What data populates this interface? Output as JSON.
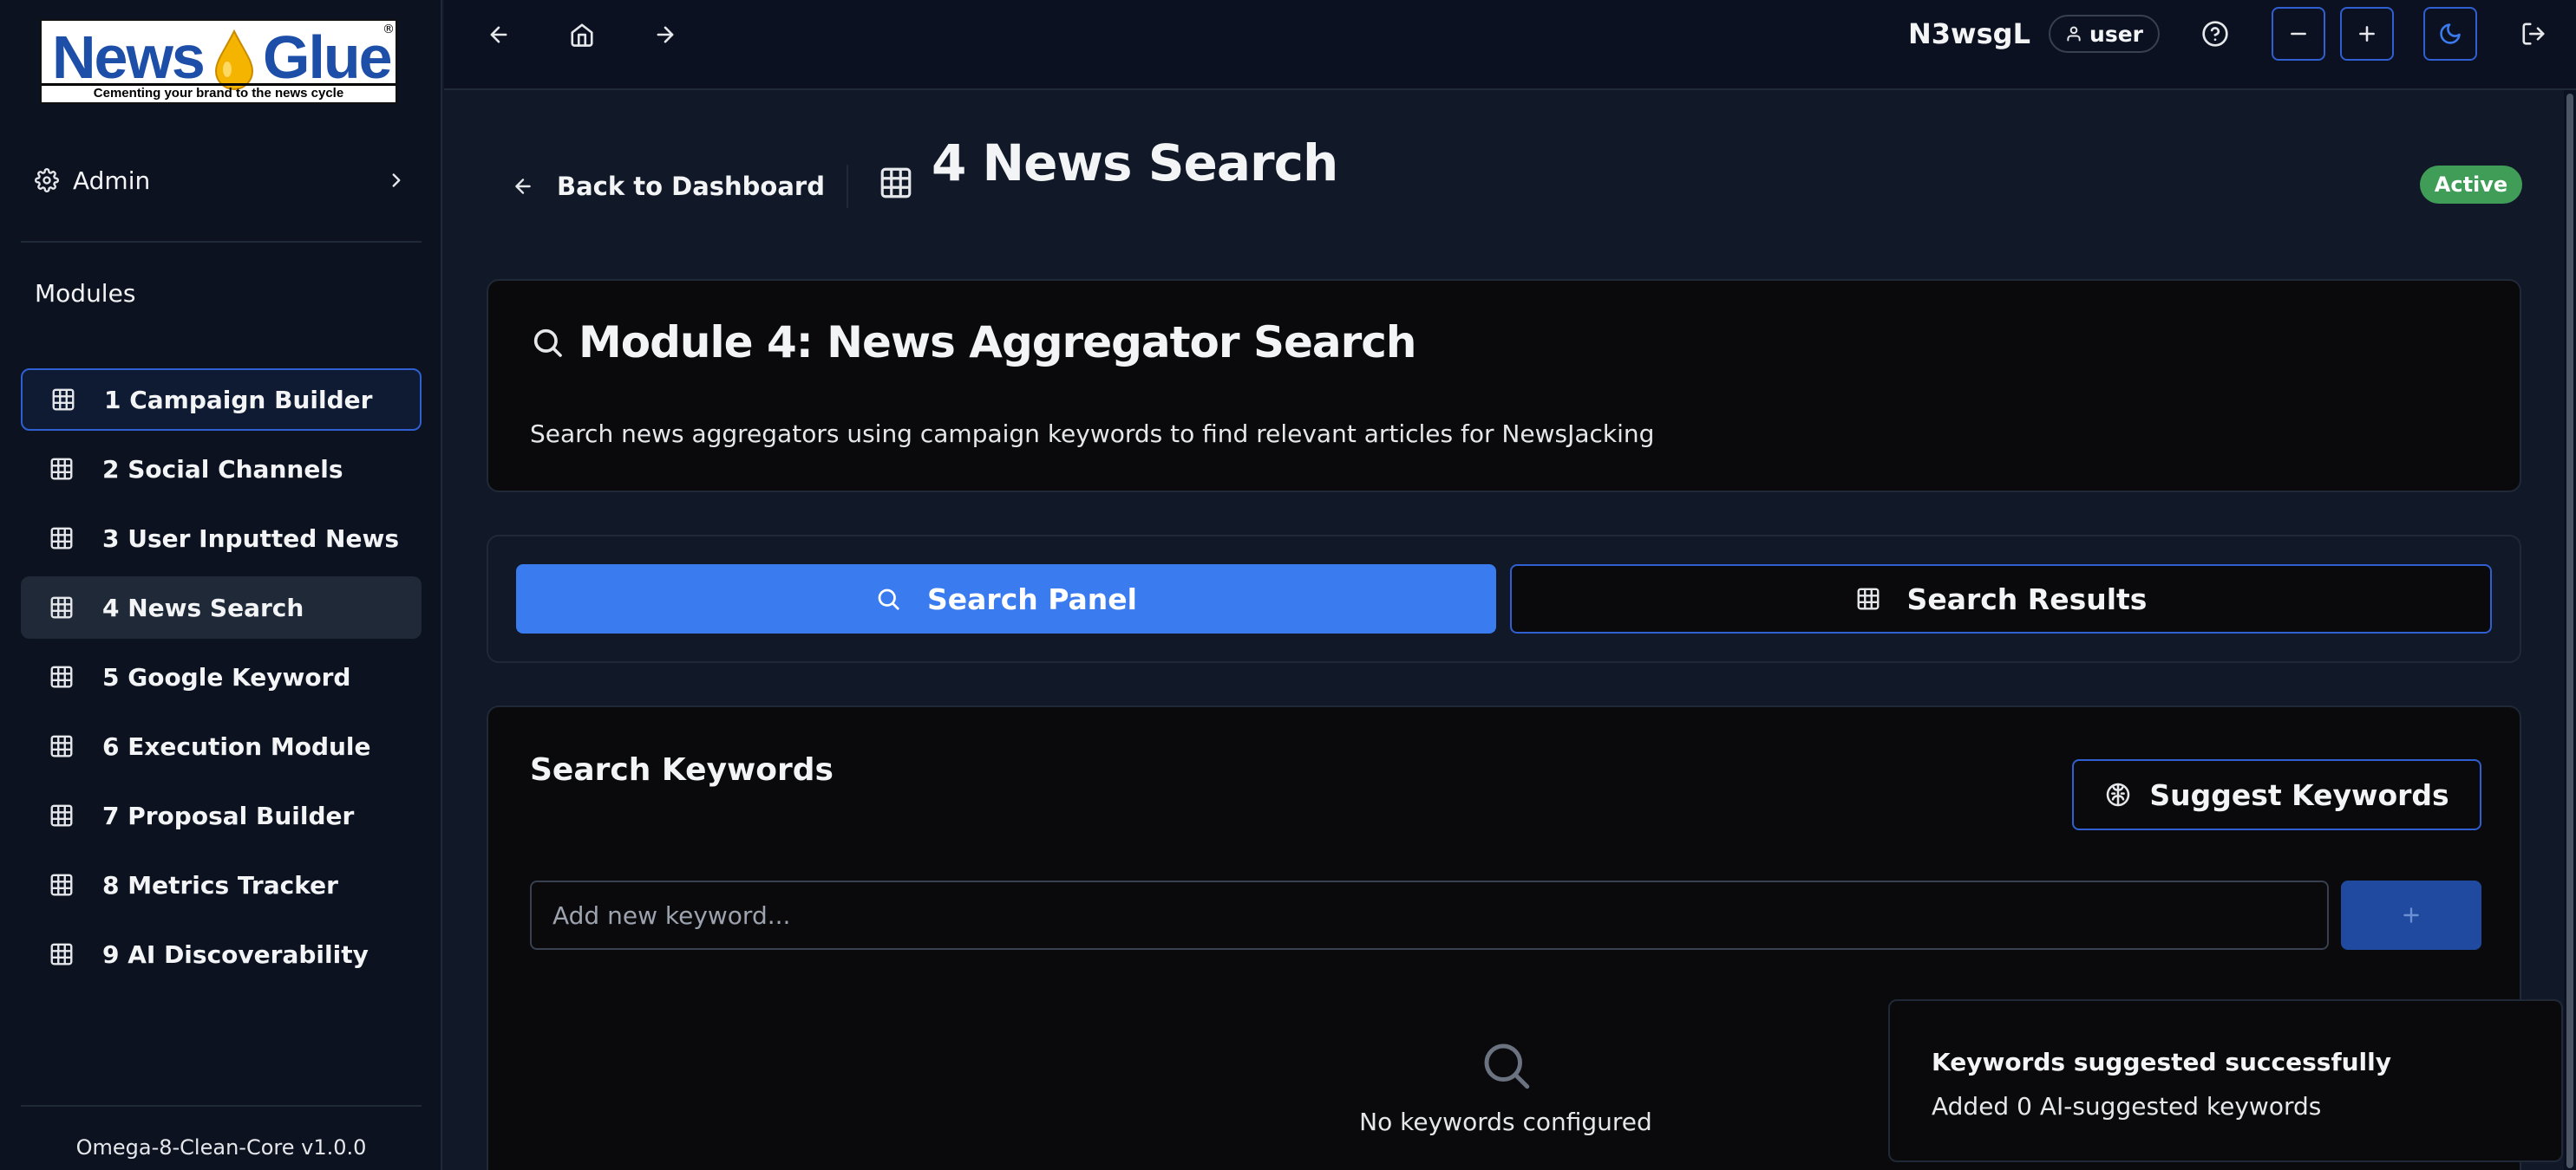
{
  "logo": {
    "brand_left": "News",
    "brand_right": "Glue",
    "tagline": "Cementing your brand to the news cycle",
    "reg_mark": "®"
  },
  "sidebar": {
    "admin_label": "Admin",
    "modules_title": "Modules",
    "items": [
      {
        "label": "1 Campaign Builder",
        "icon": "grid-icon",
        "state": "selected"
      },
      {
        "label": "2 Social Channels",
        "icon": "grid-icon",
        "state": "default"
      },
      {
        "label": "3 User Inputted News",
        "icon": "grid-icon",
        "state": "default"
      },
      {
        "label": "4 News Search",
        "icon": "grid-icon",
        "state": "active"
      },
      {
        "label": "5 Google Keyword",
        "icon": "grid-icon",
        "state": "default"
      },
      {
        "label": "6 Execution Module",
        "icon": "grid-icon",
        "state": "default"
      },
      {
        "label": "7 Proposal Builder",
        "icon": "grid-icon",
        "state": "default"
      },
      {
        "label": "8 Metrics Tracker",
        "icon": "grid-icon",
        "state": "default"
      },
      {
        "label": "9 AI Discoverability",
        "icon": "grid-icon",
        "state": "default"
      }
    ],
    "version": "Omega-8-Clean-Core v1.0.0"
  },
  "topbar": {
    "nav_icons": [
      "arrow-left-icon",
      "home-icon",
      "arrow-right-icon"
    ],
    "title": "N3wsgL",
    "user_label": "user",
    "actions": [
      "help-icon",
      "minus-icon",
      "plus-icon",
      "moon-icon",
      "logout-icon"
    ]
  },
  "header": {
    "back_label": "Back to Dashboard",
    "page_title": "4 News Search",
    "status": "Active"
  },
  "module": {
    "title": "Module 4: News Aggregator Search",
    "description": "Search news aggregators using campaign keywords to find relevant articles for NewsJacking"
  },
  "tabs": [
    {
      "label": "Search Panel",
      "icon": "search-icon",
      "active": true
    },
    {
      "label": "Search Results",
      "icon": "grid-icon",
      "active": false
    }
  ],
  "keywords": {
    "title": "Search Keywords",
    "suggest_label": "Suggest Keywords",
    "input_placeholder": "Add new keyword...",
    "input_value": "",
    "empty_text": "No keywords configured"
  },
  "toast": {
    "title": "Keywords suggested successfully",
    "message": "Added 0 AI-suggested keywords"
  },
  "colors": {
    "background": "#111827",
    "sidebar": "#0d1220",
    "card": "#0a0a0c",
    "accent": "#3b7bf0",
    "accent_border": "#2f5fd0",
    "status_green": "#3f9d58"
  }
}
